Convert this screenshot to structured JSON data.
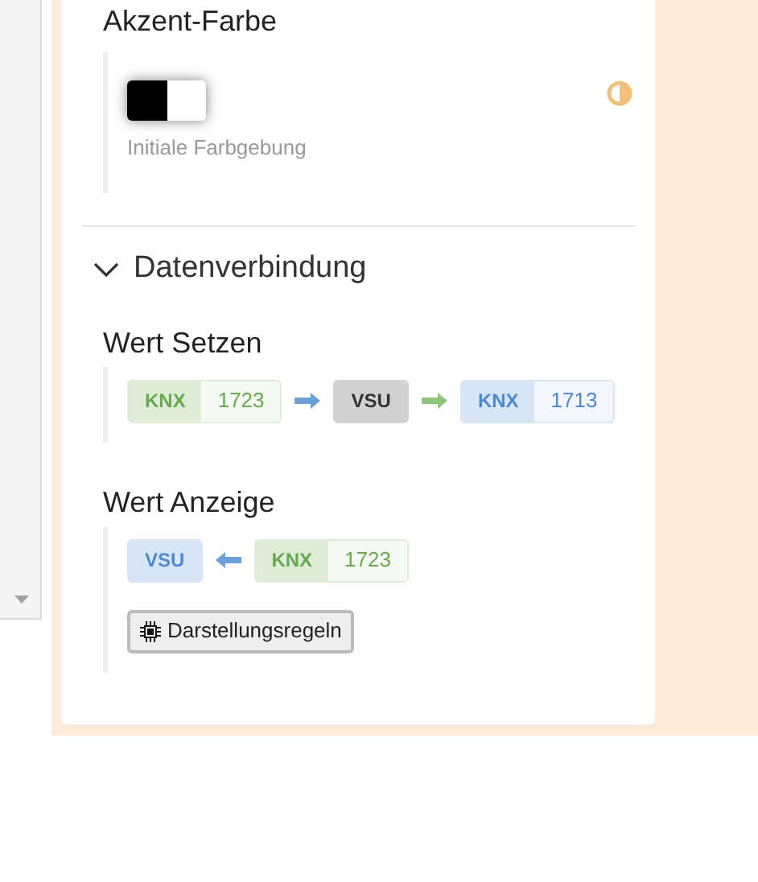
{
  "accent": {
    "title": "Akzent-Farbe",
    "caption": "Initiale Farbgebung"
  },
  "section": {
    "title": "Datenverbindung",
    "expanded": true
  },
  "groups": [
    {
      "title": "Wert Setzen",
      "chain": [
        {
          "kind": "badge",
          "color": "#6aa84f",
          "label": "KNX",
          "value": "1723"
        },
        {
          "kind": "arrow_right",
          "color": "#6a9fd8"
        },
        {
          "kind": "badge",
          "color": "#333333",
          "label": "VSU"
        },
        {
          "kind": "arrow_right",
          "color": "#8fc47a"
        },
        {
          "kind": "badge",
          "color": "#4f8ad1",
          "label": "KNX",
          "value": "1713"
        }
      ]
    },
    {
      "title": "Wert Anzeige",
      "chain": [
        {
          "kind": "badge",
          "color": "#4f8ad1",
          "label": "VSU"
        },
        {
          "kind": "arrow_left",
          "color": "#6a9fd8"
        },
        {
          "kind": "badge",
          "color": "#6aa84f",
          "label": "KNX",
          "value": "1723"
        }
      ],
      "button": "Darstellungsregeln"
    }
  ]
}
